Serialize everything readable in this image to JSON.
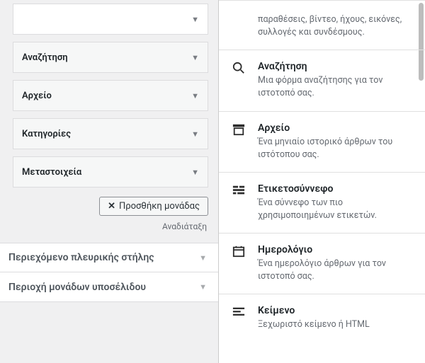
{
  "left": {
    "widgets": [
      {
        "label": ""
      },
      {
        "label": "Αναζήτηση"
      },
      {
        "label": "Αρχείο"
      },
      {
        "label": "Κατηγορίες"
      },
      {
        "label": "Μεταστοιχεία"
      }
    ],
    "add_label": "Προσθήκη μονάδας",
    "reorder_label": "Αναδιάταξη",
    "sections": [
      {
        "label": "Περιεχόμενο πλευρικής στήλης"
      },
      {
        "label": "Περιοχή μονάδων υποσέλιδου"
      }
    ]
  },
  "right": {
    "items": [
      {
        "icon": "",
        "title": "",
        "desc": "παραθέσεις, βίντεο, ήχους, εικόνες, συλλογές και συνδέσμους."
      },
      {
        "icon": "search",
        "title": "Αναζήτηση",
        "desc": "Μια φόρμα αναζήτησης για τον ιστοτοπό σας."
      },
      {
        "icon": "archive",
        "title": "Αρχείο",
        "desc": "Ένα μηνιαίο ιστορικό άρθρων του ιστότοπου σας."
      },
      {
        "icon": "tagcloud",
        "title": "Ετικετοσύννεφο",
        "desc": "Ένα σύννεφο των πιο χρησιμοποιημένων ετικετών."
      },
      {
        "icon": "calendar",
        "title": "Ημερολόγιο",
        "desc": "Ένα ημερολόγιο άρθρων για τον ιστοτοπό σας."
      },
      {
        "icon": "text",
        "title": "Κείμενο",
        "desc": "Ξεχωριστό κείμενο ή HTML"
      }
    ]
  }
}
